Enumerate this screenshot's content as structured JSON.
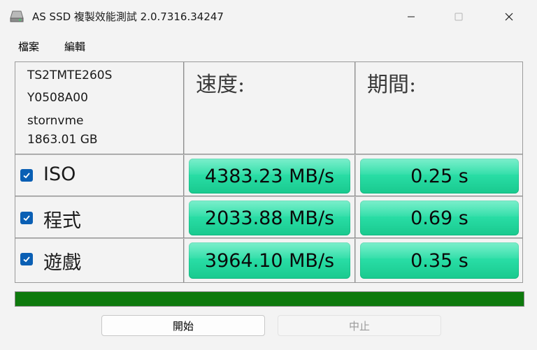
{
  "window": {
    "title": "AS SSD 複製效能測試 2.0.7316.34247",
    "icon": "hdd-icon"
  },
  "menu": {
    "file": "檔案",
    "edit": "編輯"
  },
  "drive": {
    "model": "TS2TMTE260S",
    "firmware": "Y0508A00",
    "driver": "stornvme",
    "size": "1863.01 GB"
  },
  "headers": {
    "speed": "速度:",
    "time": "期間:"
  },
  "rows": [
    {
      "label": "ISO",
      "checked": true,
      "speed": "4383.23 MB/s",
      "time": "0.25 s"
    },
    {
      "label": "程式",
      "checked": true,
      "speed": "2033.88 MB/s",
      "time": "0.69 s"
    },
    {
      "label": "遊戲",
      "checked": true,
      "speed": "3964.10 MB/s",
      "time": "0.35 s"
    }
  ],
  "progress": {
    "percent": 100,
    "color": "#0e7a0d"
  },
  "buttons": {
    "start": "開始",
    "stop": "中止"
  },
  "colors": {
    "result_green": "#28dca4",
    "checkbox_blue": "#0a5fb4"
  }
}
